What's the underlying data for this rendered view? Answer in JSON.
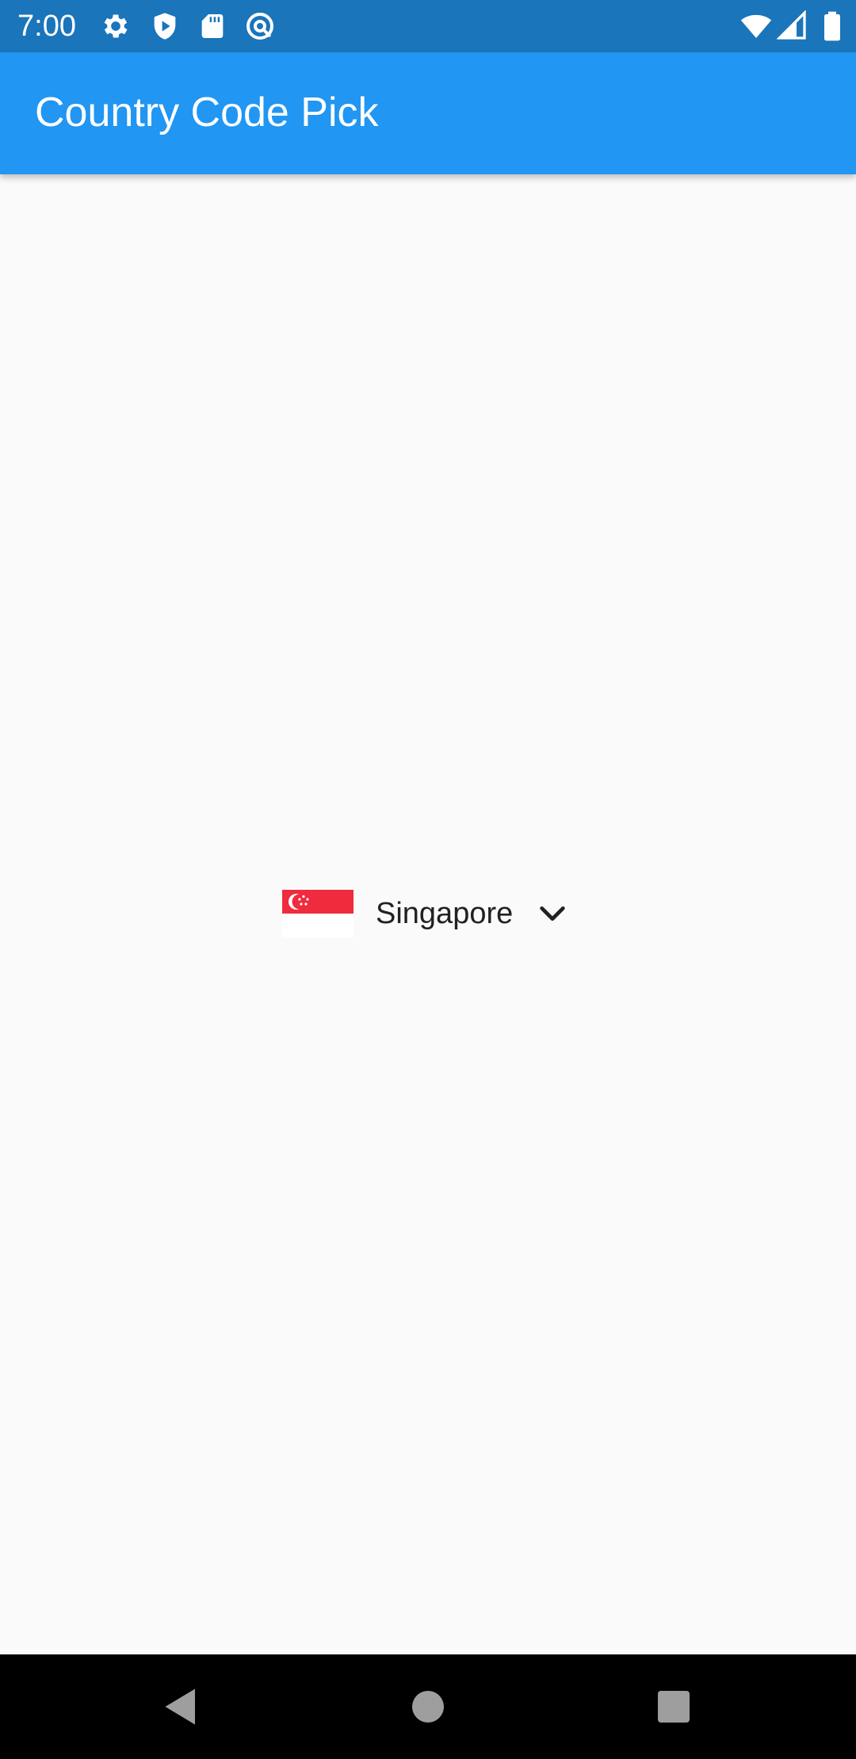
{
  "status_bar": {
    "time": "7:00",
    "left_icons": [
      "gear-icon",
      "shield-play-icon",
      "sd-card-icon",
      "at-sign-icon"
    ],
    "right_icons": [
      "wifi-icon",
      "cell-signal-icon",
      "battery-icon"
    ],
    "background": "#1a75ba"
  },
  "app_bar": {
    "title": "Country Code Pick",
    "background": "#2196f3"
  },
  "picker": {
    "country_name": "Singapore",
    "flag": "singapore-flag",
    "dropdown_icon": "chevron-down-icon"
  },
  "nav_bar": {
    "buttons": [
      "back-icon",
      "home-icon",
      "recents-icon"
    ]
  }
}
